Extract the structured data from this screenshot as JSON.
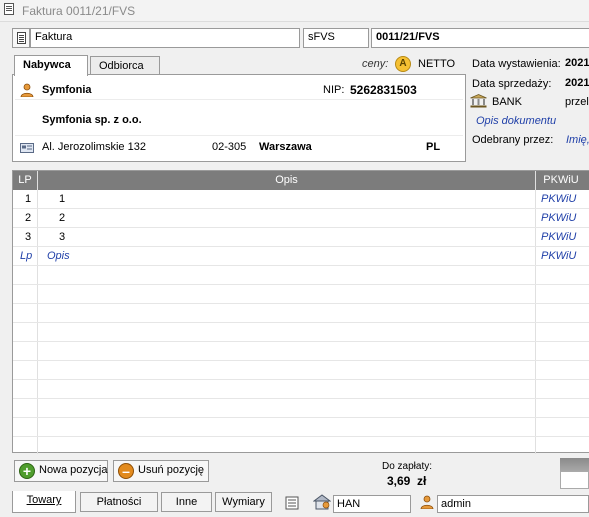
{
  "window": {
    "title": "Faktura 0011/21/FVS"
  },
  "header": {
    "doc_type": "Faktura",
    "series": "sFVS",
    "doc_number": "0011/21/FVS"
  },
  "party_tabs": [
    {
      "label": "Nabywca"
    },
    {
      "label": "Odbiorca"
    }
  ],
  "prices": {
    "label": "ceny:",
    "badge": "A",
    "mode": "NETTO"
  },
  "buyer": {
    "short_name": "Symfonia",
    "nip_label": "NIP:",
    "nip": "5262831503",
    "full_name": "Symfonia sp. z o.o.",
    "street": "Al. Jerozolimskie 132",
    "postal_code": "02-305",
    "city": "Warszawa",
    "country": "PL"
  },
  "right_panel": {
    "issue_date_label": "Data wystawienia:",
    "issue_date_value": "2021",
    "sale_date_label": "Data sprzedaży:",
    "sale_date_value": "2021",
    "payment_method": "BANK",
    "payment_extra": "przele",
    "doc_description": "Opis dokumentu",
    "received_by_label": "Odebrany przez:",
    "received_by_value": "Imię,"
  },
  "table": {
    "columns": [
      {
        "label": "LP"
      },
      {
        "label": "Opis"
      },
      {
        "label": "PKWiU"
      }
    ],
    "rows": [
      {
        "lp": "1",
        "desc": "1",
        "pkwiu": "PKWiU"
      },
      {
        "lp": "2",
        "desc": "2",
        "pkwiu": "PKWiU"
      },
      {
        "lp": "3",
        "desc": "3",
        "pkwiu": "PKWiU"
      }
    ],
    "placeholder_row": {
      "lp": "Lp",
      "desc": "Opis",
      "pkwiu": "PKWiU"
    }
  },
  "actions": {
    "add_label": "Nowa pozycja",
    "delete_label": "Usuń pozycję"
  },
  "total": {
    "label": "Do zapłaty:",
    "value": "3,69",
    "currency": "zł"
  },
  "bottom_tabs": [
    {
      "label": "Towary"
    },
    {
      "label": "Płatności"
    },
    {
      "label": "Inne"
    },
    {
      "label": "Wymiary"
    }
  ],
  "status": {
    "warehouse": "HAN",
    "user": "admin"
  },
  "colors": {
    "accent_blue": "#1f3fa8",
    "header_gray": "#7c7c7c",
    "add_green": "#4f9d2d",
    "delete_orange": "#e28a1d"
  }
}
